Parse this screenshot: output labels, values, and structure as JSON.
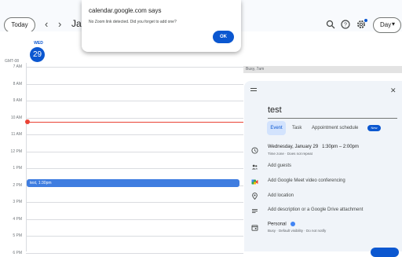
{
  "toolbar": {
    "today_label": "Today",
    "prev_icon": "chevron-left-icon",
    "next_icon": "chevron-right-icon",
    "month_title": "Ja",
    "view_label": "Day",
    "accent_color": "#0b57d0"
  },
  "day_header": {
    "day_name": "WED",
    "day_number": "29",
    "timezone": "GMT-08"
  },
  "hours": [
    "7 AM",
    "8 AM",
    "9 AM",
    "10 AM",
    "11 AM",
    "12 PM",
    "1 PM",
    "2 PM",
    "3 PM",
    "4 PM",
    "5 PM",
    "6 PM"
  ],
  "busy_label": "Busy, 7am",
  "event_chip_label": "test, 1:30pm",
  "now_line_color": "#ea4335",
  "panel": {
    "title_value": "test",
    "tabs": [
      "Event",
      "Task",
      "Appointment schedule"
    ],
    "new_badge": "New",
    "datetime_date": "Wednesday, January 29",
    "datetime_time": "1:30pm – 2:00pm",
    "datetime_sub": "Time zone · Does not repeat",
    "add_guests": "Add guests",
    "add_meet": "Add Google Meet video conferencing",
    "add_location": "Add location",
    "add_description": "Add description or a Google Drive attachment",
    "calendar_name": "Personal",
    "calendar_sub": "Busy · Default visibility · Do not notify"
  },
  "dialog": {
    "title": "calendar.google.com says",
    "message": "No Zoom link detected. Did you forget to add one?",
    "ok_label": "OK"
  }
}
